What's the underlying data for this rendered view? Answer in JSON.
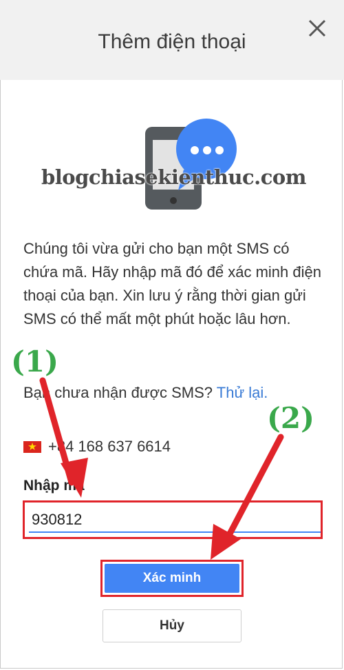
{
  "dialog": {
    "title": "Thêm điện thoại",
    "message": "Chúng tôi vừa gửi cho bạn một SMS có chứa mã. Hãy nhập mã đó để xác minh điện thoại của bạn. Xin lưu ý rằng thời gian gửi SMS có thể mất một phút hoặc lâu hơn.",
    "resend_prefix": "Bạn chưa nhận được SMS?",
    "resend_link": "Thử lại.",
    "phone_number": "+84 168 637 6614",
    "code_label": "Nhập mã",
    "code_value": "930812",
    "verify_label": "Xác minh",
    "cancel_label": "Hủy"
  },
  "icons": {
    "close": "close-icon",
    "phone": "phone-icon",
    "chat": "chat-bubble-icon",
    "flag": "vietnam-flag-icon"
  },
  "watermark": "blogchiasekienthuc.com",
  "annotations": {
    "step1": "(1)",
    "step2": "(2)"
  },
  "colors": {
    "primary": "#4285f4",
    "link": "#3a7bd5",
    "highlight": "#e0242a",
    "annotation": "#3aa84b"
  }
}
